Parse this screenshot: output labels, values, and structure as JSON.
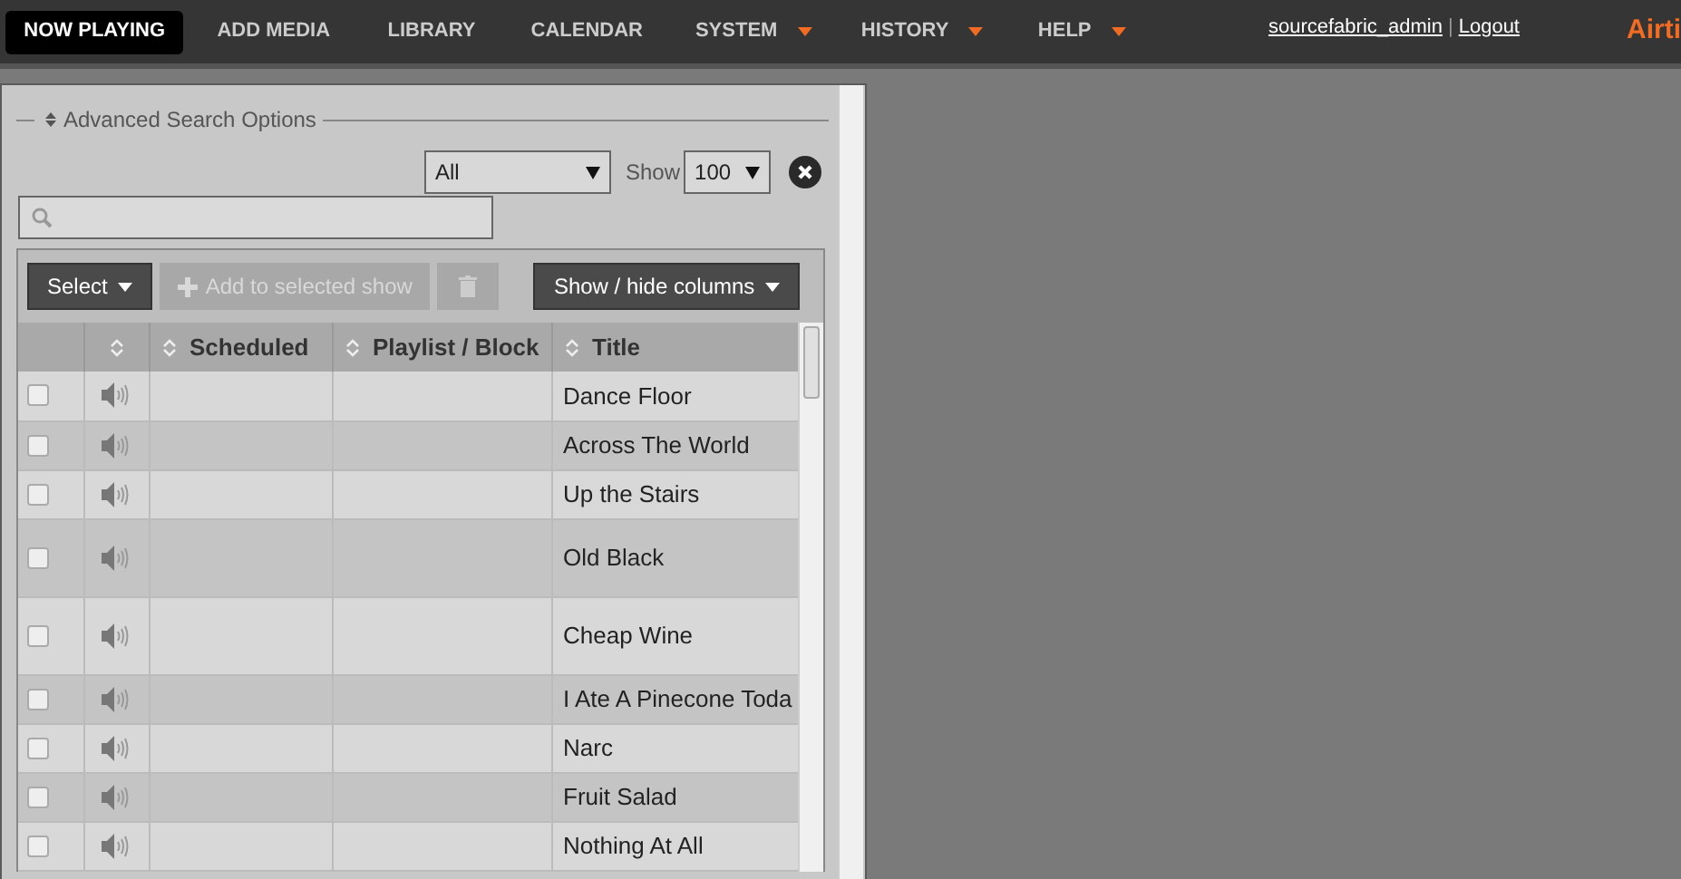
{
  "nav": {
    "items": [
      {
        "label": "NOW PLAYING",
        "selected": true,
        "dropdown": false
      },
      {
        "label": "ADD MEDIA",
        "selected": false,
        "dropdown": false
      },
      {
        "label": "LIBRARY",
        "selected": false,
        "dropdown": false
      },
      {
        "label": "CALENDAR",
        "selected": false,
        "dropdown": false
      },
      {
        "label": "SYSTEM",
        "selected": false,
        "dropdown": true
      },
      {
        "label": "HISTORY",
        "selected": false,
        "dropdown": true
      },
      {
        "label": "HELP",
        "selected": false,
        "dropdown": true
      }
    ],
    "user": "sourcefabric_admin",
    "separator": "|",
    "logout": "Logout",
    "brand": "Airti"
  },
  "library": {
    "advanced_search": "Advanced Search Options",
    "type_filter": "All",
    "show_label": "Show",
    "page_size": "100",
    "toolbar": [
      "Select",
      "Add to selected show",
      "Show / hide columns"
    ],
    "columns": [
      "Scheduled",
      "Playlist / Block",
      "Title"
    ],
    "rows": [
      {
        "checked": false,
        "title": "Dance Floor"
      },
      {
        "checked": false,
        "title": "Across The World"
      },
      {
        "checked": false,
        "title": "Up the Stairs"
      },
      {
        "checked": false,
        "title": "Old Black"
      },
      {
        "checked": false,
        "title": "Cheap Wine"
      },
      {
        "checked": false,
        "title": "I Ate A Pinecone Toda"
      },
      {
        "checked": false,
        "title": "Narc"
      },
      {
        "checked": false,
        "title": "Fruit Salad"
      },
      {
        "checked": false,
        "title": "Nothing At All"
      }
    ]
  }
}
